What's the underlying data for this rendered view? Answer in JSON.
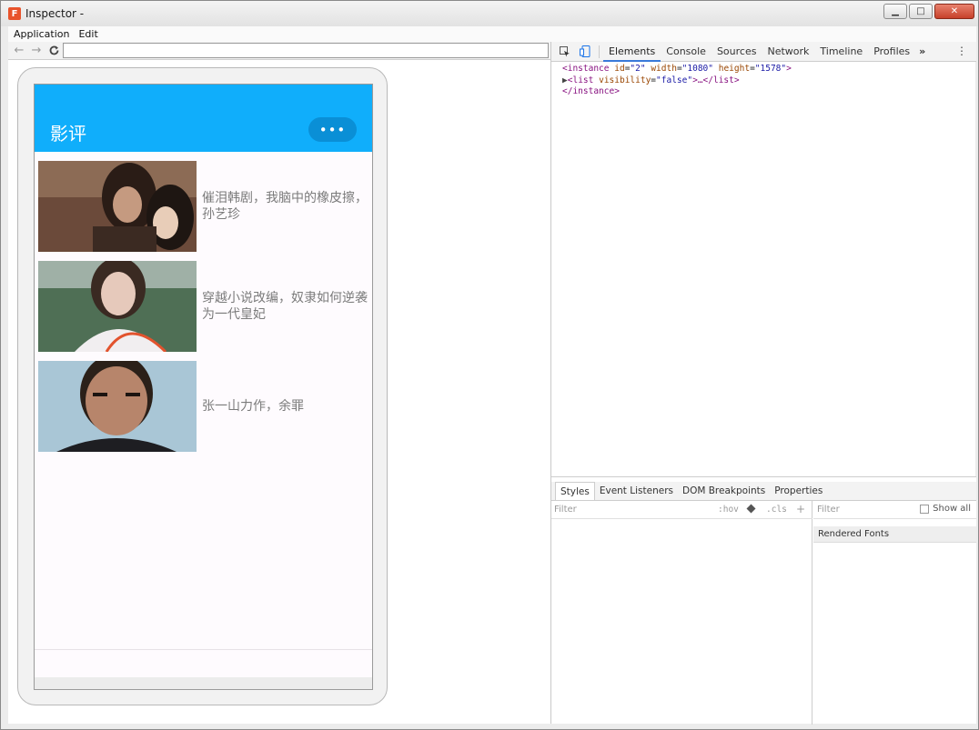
{
  "window": {
    "title": "Inspector -",
    "app_icon": "F",
    "minimize": "▁",
    "maximize": "□",
    "close": "✕"
  },
  "menu": {
    "items": [
      "Application",
      "Edit"
    ]
  },
  "address": {
    "back": "←",
    "forward": "→",
    "reload": "C",
    "url": ""
  },
  "app": {
    "title": "影评",
    "more_label": "•••",
    "header_color": "#10aefb",
    "items": [
      {
        "text": "催泪韩剧，我脑中的橡皮擦，\n孙艺珍"
      },
      {
        "text": "穿越小说改编，奴隶如何逆袭\n为一代皇妃"
      },
      {
        "text": "张一山力作，余罪"
      }
    ]
  },
  "devtools": {
    "tabs": [
      "Elements",
      "Console",
      "Sources",
      "Network",
      "Timeline",
      "Profiles"
    ],
    "active_tab": "Elements",
    "more": "»",
    "kebab": "⋮",
    "dom": {
      "line1": {
        "open": "<",
        "tag": "instance",
        "a1": "id",
        "v1": "\"2\"",
        "a2": "width",
        "v2": "\"1080\"",
        "a3": "height",
        "v3": "\"1578\"",
        "close": ">"
      },
      "line2": {
        "tri": "▶",
        "open": "<",
        "tag": "list",
        "a1": "visibility",
        "v1": "\"false\"",
        "mid": ">…</",
        "close_tag": "list",
        "close": ">"
      },
      "line3": {
        "text": "</instance>"
      }
    },
    "styles": {
      "tabs": [
        "Styles",
        "Event Listeners",
        "DOM Breakpoints",
        "Properties"
      ],
      "filter_placeholder": "Filter",
      "hov": ":hov",
      "cls": ".cls",
      "plus": "+",
      "right_filter": "Filter",
      "show_all": "Show all",
      "rendered_fonts": "Rendered Fonts"
    }
  }
}
